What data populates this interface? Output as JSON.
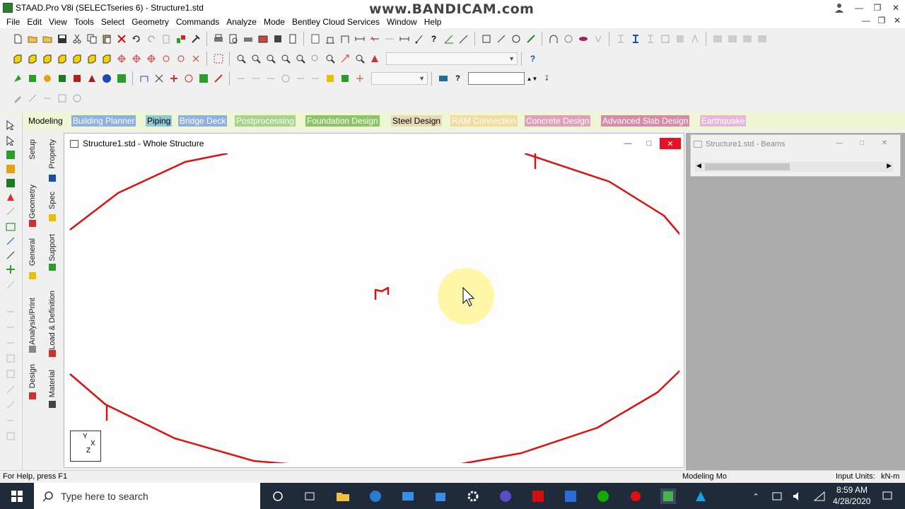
{
  "titlebar": {
    "title": "STAAD.Pro V8i (SELECTseries 6) - Structure1.std",
    "watermark": "www.BANDICAM.com",
    "icons": [
      "user-icon",
      "minimize-icon",
      "restore-icon",
      "close-icon"
    ]
  },
  "menu": [
    "File",
    "Edit",
    "View",
    "Tools",
    "Select",
    "Geometry",
    "Commands",
    "Analyze",
    "Mode",
    "Bentley Cloud Services",
    "Window",
    "Help"
  ],
  "page_tabs": [
    {
      "label": "Modeling",
      "color": "#000000",
      "bg": "#eef6d6"
    },
    {
      "label": "Building Planner",
      "color": "#ffffff",
      "bg": "#8fb0e0"
    },
    {
      "label": "Piping",
      "color": "#000000",
      "bg": "#8fc8d8"
    },
    {
      "label": "Bridge Deck",
      "color": "#ffffff",
      "bg": "#8fb0e0"
    },
    {
      "label": "Postprocessing",
      "color": "#ffffff",
      "bg": "#a6d48c"
    },
    {
      "label": "Foundation Design",
      "color": "#ffffff",
      "bg": "#8cc46a"
    },
    {
      "label": "Steel Design",
      "color": "#000000",
      "bg": "#e8d9b8"
    },
    {
      "label": "RAM Connection",
      "color": "#ffffff",
      "bg": "#f3dca0"
    },
    {
      "label": "Concrete Design",
      "color": "#ffffff",
      "bg": "#e0a0b8"
    },
    {
      "label": "Advanced Slab Design",
      "color": "#ffffff",
      "bg": "#d58aa8"
    },
    {
      "label": "Earthquake",
      "color": "#ffffff",
      "bg": "#e6b7d6"
    }
  ],
  "vertical_tabs": {
    "col1": [
      "Setup",
      "Geometry",
      "General",
      "Analysis/Print",
      "Design"
    ],
    "col2": [
      "Property",
      "Spec",
      "Support",
      "Load & Definition",
      "Material"
    ]
  },
  "main_window": {
    "title": "Structure1.std - Whole Structure",
    "axis_label_y": "Y",
    "axis_label_x": "X",
    "axis_label_z": "Z"
  },
  "side_window": {
    "title": "Structure1.std - Beams"
  },
  "statusbar": {
    "help": "For Help, press F1",
    "mode": "Modeling Mo",
    "units_label": "Input Units:",
    "units_value": "kN-m"
  },
  "taskbar": {
    "search_placeholder": "Type here to search",
    "time": "8:59 AM",
    "date": "4/28/2020"
  },
  "colors": {
    "member_red": "#e01010",
    "cursor_highlight": "#fff6a8"
  }
}
